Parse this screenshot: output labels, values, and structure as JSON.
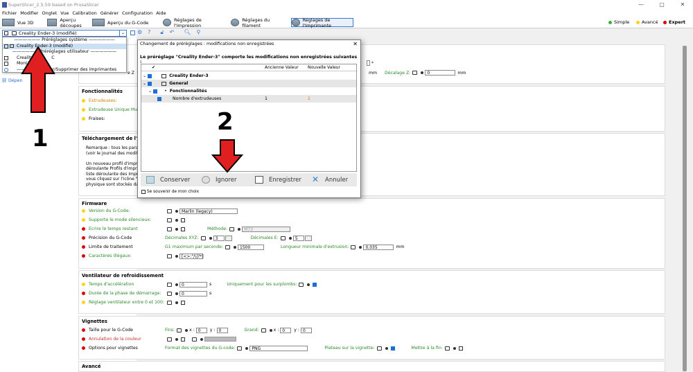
{
  "window": {
    "title": "SuperSlicer_2.5.59 based on PrusaSlicer",
    "min": "—",
    "max": "▢",
    "close": "✕"
  },
  "menu": [
    "Fichier",
    "Modifier",
    "Onglet",
    "Vue",
    "Calibration",
    "Générer",
    "Configuration",
    "Aide"
  ],
  "tabs": [
    "Vue 3D",
    "Aperçu découpes",
    "Aperçu du G-Code",
    "Réglages de l'Impression",
    "Réglages du filament",
    "Réglages de l'Imprimante"
  ],
  "modes": {
    "simple": "Simple",
    "advanced": "Avancé",
    "expert": "Expert"
  },
  "colors": {
    "simple": "#3cb043",
    "advanced": "#ffd21a",
    "expert": "#d00000",
    "accent": "#3a7ad0",
    "modified": "#e67e22"
  },
  "sidebar": {
    "combo_value": "Creality Ender-3 (modifié)",
    "dropdown": [
      "Préréglages système",
      "Creality Ender-3 (modifié)",
      "Préréglages utilisateur",
      "Creality E",
      "MonU",
      "Ajouter/Supprimer des imprimantes"
    ],
    "dropdown_suffix_c": "C",
    "depend": "Dépen"
  },
  "behind": {
    "z_label": "e Z",
    "mm1": "mm",
    "decalage": "Décalage Z:",
    "decalage_val": "0",
    "mm2": "mm",
    "star": "*"
  },
  "fonctionnalites": {
    "title": "Fonctionnalités",
    "items": [
      "Extrudeuses:",
      "Extrudeuse Unique Multi-",
      "Fraises:"
    ]
  },
  "telechargement": {
    "title": "Téléchargement de l'Hôte d",
    "lines": [
      "Remarque : tous les paramè",
      "(voir le journal des modific",
      "",
      "Un nouveau profil d'imprim",
      "déroulante Profils d'imprim",
      "liste déroulante des Imprim",
      "vous cliquez sur l'icône \"en",
      "physique sont stockés dans"
    ]
  },
  "firmware": {
    "title": "Firmware",
    "version_label": "Version du G-Code:",
    "version_value": "Marlin (legacy)",
    "silent_label": "Supporte le mode silencieux:",
    "temps_label": "Ecrire le temps restant",
    "methode_label": "Méthode:",
    "methode_value": "M73",
    "precision_label": "Précision du G-Code",
    "dec_xyz_label": "Décimales XYZ:",
    "dec_xyz_value": "3",
    "dec_e_label": "Décimales E:",
    "dec_e_value": "5",
    "limite_label": "Limite de traitement",
    "g1_label": "G1 maximum par seconde:",
    "g1_value": "1500",
    "longueur_label": "Longueur minimale d'extrusion:",
    "longueur_value": "0,035",
    "mm": "mm",
    "illegal_label": "Caractères illégaux:",
    "illegal_value": "[<>:\"/\\|?*]"
  },
  "ventilateur": {
    "title": "Ventilateur de refroidissement",
    "accel_label": "Temps d'accélération",
    "accel_value": "0",
    "s1": "s",
    "surplomb_label": "Uniquement pour les surplombs:",
    "demarrage_label": "Durée de la phase de démarrage:",
    "demarrage_value": "0",
    "s2": "s",
    "reglage_label": "Réglage ventilateur entre 0 et 100:"
  },
  "vignettes": {
    "title": "Vignettes",
    "taille_label": "Taille pour le G-Code",
    "fins_label": "Fins:",
    "x1": "x :",
    "x1_val": "0",
    "y1": "y :",
    "y1_val": "0",
    "grand_label": "Grand:",
    "x2": "x :",
    "x2_val": "0",
    "y2": "y :",
    "y2_val": "0",
    "annulation_label": "Annulation de la couleur",
    "options_label": "Options pour vignettes",
    "format_label": "Format des vignettes du G-code:",
    "format_value": "PNG",
    "plateau_label": "Plateau sur la vignette:",
    "mettre_label": "Mettre à la fin:"
  },
  "avance": {
    "title": "Avancé"
  },
  "dialog": {
    "title": "Changement de préréglages : modifications non enregistrées",
    "close": "✕",
    "message": "Le préréglage \"Creality Ender-3\" comporte les modifications non enregistrées suivantes :",
    "col_check": "✔",
    "col_old": "Ancienne Valeur",
    "col_new": "Nouvelle Valeur",
    "rows": [
      {
        "label": "Creality Ender-3",
        "old": "",
        "new": ""
      },
      {
        "label": "General",
        "old": "",
        "new": ""
      },
      {
        "label": "Fonctionnalités",
        "old": "",
        "new": ""
      },
      {
        "label": "Nombre d'extrudeuses",
        "old": "1",
        "new": "2"
      }
    ],
    "buttons": [
      "Conserver",
      "Ignorer",
      "Enregistrer",
      "Annuler"
    ],
    "remember": "Se souvenir de mon choix"
  },
  "annotations": {
    "n1": "1",
    "n2": "2"
  }
}
